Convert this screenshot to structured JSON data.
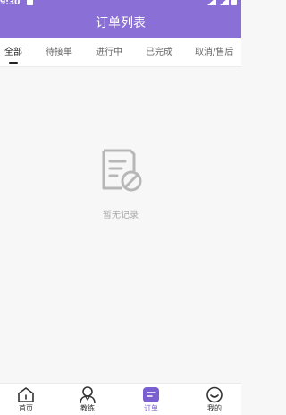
{
  "status_bar": {
    "time": "9:30"
  },
  "header": {
    "title": "订单列表"
  },
  "tabs": [
    {
      "label": "全部",
      "active": true
    },
    {
      "label": "待接单",
      "active": false
    },
    {
      "label": "进行中",
      "active": false
    },
    {
      "label": "已完成",
      "active": false
    },
    {
      "label": "取消/售后",
      "active": false
    }
  ],
  "empty_state": {
    "icon": "no-record-document-icon",
    "text": "暂无记录"
  },
  "bottom_nav": [
    {
      "label": "首页",
      "icon": "home-icon",
      "active": false
    },
    {
      "label": "教练",
      "icon": "coach-person-icon",
      "active": false
    },
    {
      "label": "订单",
      "icon": "order-icon",
      "active": true
    },
    {
      "label": "我的",
      "icon": "profile-smile-icon",
      "active": false
    }
  ],
  "colors": {
    "accent": "#8a6fd6",
    "active_nav": "#7a5fd0"
  }
}
